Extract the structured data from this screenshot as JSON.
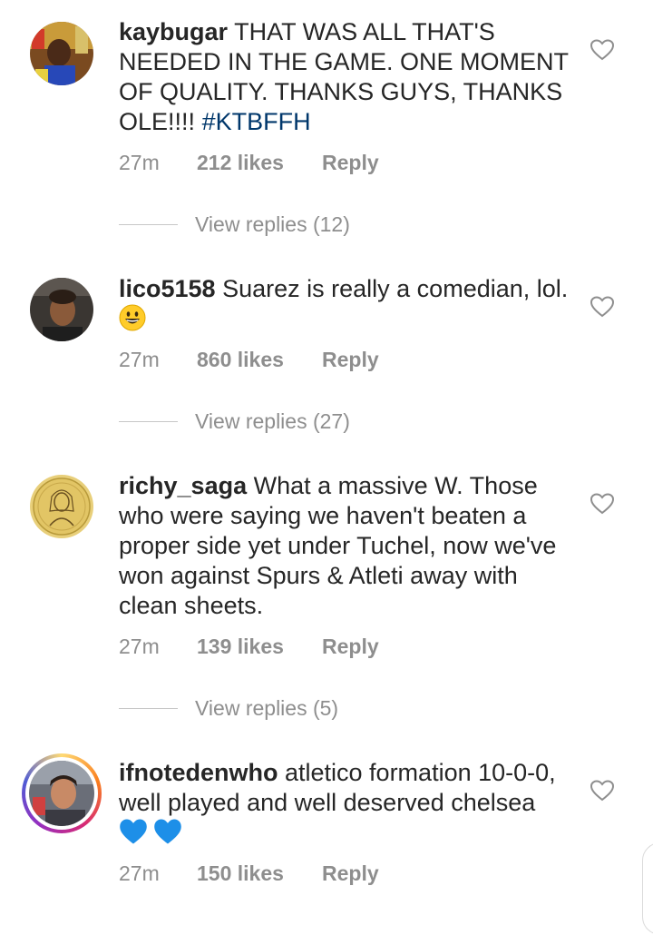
{
  "comments": [
    {
      "username": "kaybugar",
      "text": "THAT WAS ALL THAT'S NEEDED IN THE GAME. ONE MOMENT OF QUALITY. THANKS GUYS, THANKS OLE!!!!",
      "hashtag": "#KTBFFH",
      "time": "27m",
      "likes": "212 likes",
      "reply": "Reply",
      "view_replies": "View replies (12)"
    },
    {
      "username": "lico5158",
      "text": "Suarez is really a comedian, lol.",
      "emoji": "grinning-face",
      "time": "27m",
      "likes": "860 likes",
      "reply": "Reply",
      "view_replies": "View replies (27)"
    },
    {
      "username": "richy_saga",
      "text": "What a massive W. Those who were saying we haven't beaten a proper side yet under Tuchel, now we've won against Spurs & Atleti away with clean sheets.",
      "time": "27m",
      "likes": "139 likes",
      "reply": "Reply",
      "view_replies": "View replies (5)"
    },
    {
      "username": "ifnotedenwho",
      "text": "atletico formation 10-0-0, well played and well deserved chelsea",
      "emoji": "blue-heart blue-heart",
      "time": "27m",
      "likes": "150 likes",
      "reply": "Reply"
    }
  ],
  "colors": {
    "text": "#262626",
    "meta": "#8e8e8e",
    "hashtag": "#00376b",
    "blue_heart": "#1d8fe8"
  }
}
